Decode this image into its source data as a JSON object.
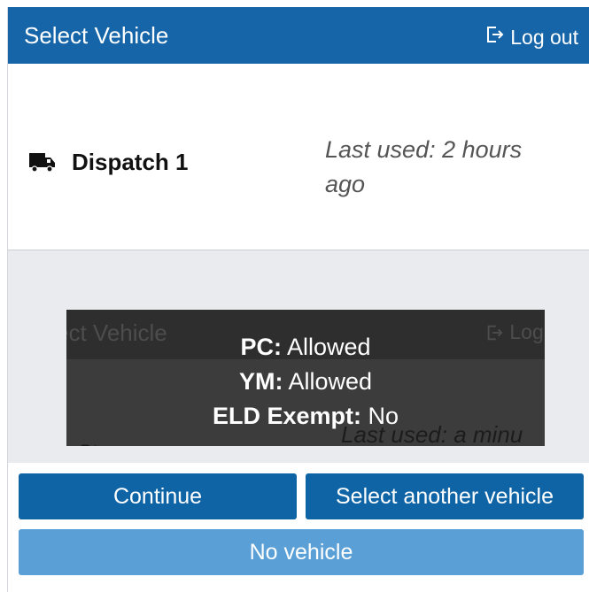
{
  "header": {
    "title": "Select Vehicle",
    "logout_label": "Log out",
    "logout_icon": "sign-out-icon",
    "background": "#1565a8"
  },
  "vehicle_card": {
    "name": "Dispatch 1",
    "icon": "truck-icon",
    "last_used": "Last used: 2 hours ago"
  },
  "tooltip": {
    "lines": [
      {
        "key": "PC:",
        "value": "Allowed"
      },
      {
        "key": "YM:",
        "value": "Allowed"
      },
      {
        "key": "ELD Exempt:",
        "value": "No"
      }
    ],
    "ghost_title": "ect Vehicle",
    "ghost_logout": "Log",
    "ghost_last_used": "Last used: a minu",
    "ghost_name": "Ct"
  },
  "buttons": {
    "continue_label": "Continue",
    "select_another_label": "Select another vehicle",
    "no_vehicle_label": "No vehicle",
    "primary_color": "#0f64a6",
    "secondary_color": "#5a9fd5"
  }
}
